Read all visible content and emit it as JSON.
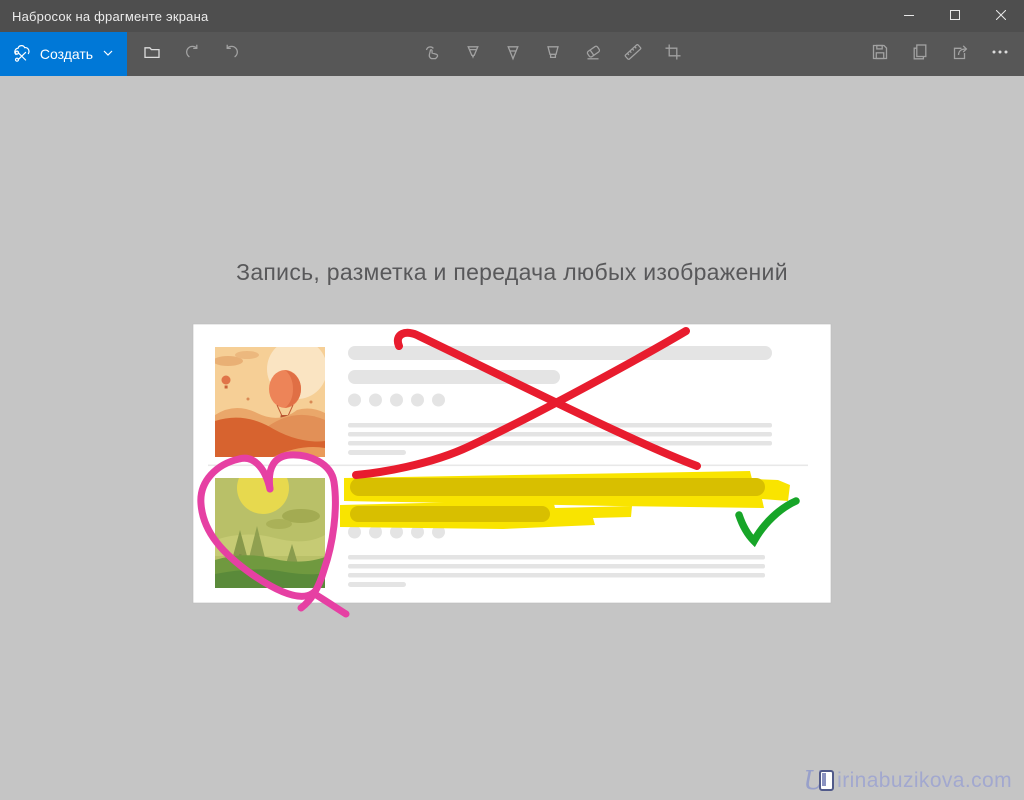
{
  "window": {
    "title": "Набросок на фрагменте экрана",
    "controls": [
      {
        "name": "minimize",
        "icon": "minimize-icon"
      },
      {
        "name": "maximize",
        "icon": "maximize-icon"
      },
      {
        "name": "close",
        "icon": "close-icon"
      }
    ]
  },
  "toolbar": {
    "new_button": {
      "label": "Создать",
      "icon": "new-snip-scissors-icon",
      "dropdown_icon": "chevron-down-icon"
    },
    "left_actions": [
      {
        "name": "open-file",
        "icon": "folder-icon",
        "disabled": false
      },
      {
        "name": "undo",
        "icon": "undo-arrow-icon",
        "disabled": true
      },
      {
        "name": "redo",
        "icon": "redo-arrow-icon",
        "disabled": true
      }
    ],
    "tools": [
      {
        "name": "touch-writing",
        "icon": "touch-writing-icon"
      },
      {
        "name": "ballpoint-pen",
        "icon": "ballpoint-pen-icon"
      },
      {
        "name": "pencil",
        "icon": "pencil-icon"
      },
      {
        "name": "highlighter",
        "icon": "highlighter-icon"
      },
      {
        "name": "eraser",
        "icon": "eraser-icon"
      },
      {
        "name": "ruler",
        "icon": "ruler-icon"
      },
      {
        "name": "crop",
        "icon": "crop-icon"
      }
    ],
    "right_actions": [
      {
        "name": "save",
        "icon": "save-icon"
      },
      {
        "name": "copy",
        "icon": "copy-icon"
      },
      {
        "name": "share",
        "icon": "share-icon"
      },
      {
        "name": "more",
        "icon": "ellipsis-icon"
      }
    ]
  },
  "canvas": {
    "heading": "Запись, разметка и передача любых изображений",
    "watermark": "irinabuzikova.com",
    "illustration_annotations": [
      "red-x-cross",
      "pink-heart-outline",
      "yellow-highlight-strokes",
      "green-checkmark"
    ]
  },
  "colors": {
    "accent_blue": "#0078d7",
    "titlebar_bg": "#4e4e4e",
    "toolbar_bg": "#575757",
    "canvas_bg": "#c5c5c5",
    "annotation_red": "#e81c2e",
    "annotation_pink": "#e640a3",
    "annotation_yellow": "#f9e400",
    "annotation_dark_yellow": "#d8bf00",
    "annotation_green": "#17a528",
    "watermark_color": "#a2a8cf"
  }
}
